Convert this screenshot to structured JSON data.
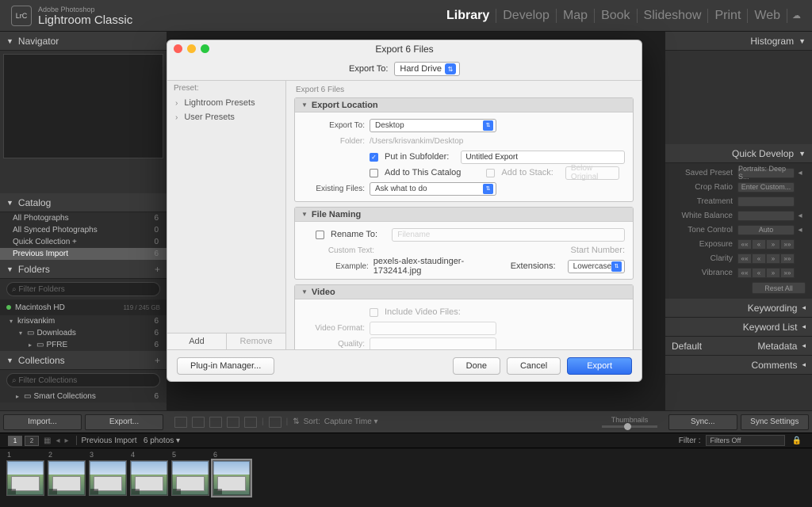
{
  "brand": {
    "sub": "Adobe Photoshop",
    "main": "Lightroom Classic",
    "logo": "LrC"
  },
  "modules": {
    "items": [
      "Library",
      "Develop",
      "Map",
      "Book",
      "Slideshow",
      "Print",
      "Web"
    ],
    "active": "Library"
  },
  "left": {
    "navigator": "Navigator",
    "catalog": {
      "title": "Catalog",
      "rows": [
        {
          "label": "All Photographs",
          "count": "6"
        },
        {
          "label": "All Synced Photographs",
          "count": "0"
        },
        {
          "label": "Quick Collection  +",
          "count": "0"
        },
        {
          "label": "Previous Import",
          "count": "6"
        }
      ],
      "selected": 3
    },
    "folders": {
      "title": "Folders",
      "search_placeholder": "Filter Folders",
      "drive": {
        "name": "Macintosh HD",
        "space": "119 / 245 GB"
      },
      "tree": [
        {
          "indent": 0,
          "exp": "▾",
          "label": "krisvankim",
          "count": "6"
        },
        {
          "indent": 1,
          "exp": "▾",
          "label": "Downloads",
          "count": "6"
        },
        {
          "indent": 2,
          "exp": "▸",
          "label": "PFRE",
          "count": "6"
        }
      ]
    },
    "collections": {
      "title": "Collections",
      "search_placeholder": "Filter Collections",
      "rows": [
        {
          "label": "Smart Collections",
          "count": "6"
        }
      ]
    },
    "import_btn": "Import...",
    "export_btn": "Export..."
  },
  "right": {
    "histogram": "Histogram",
    "quick_develop": {
      "title": "Quick Develop",
      "saved_preset_lbl": "Saved Preset",
      "saved_preset_val": "Portraits: Deep S...",
      "crop_lbl": "Crop Ratio",
      "crop_val": "Enter Custom...",
      "treatment_lbl": "Treatment",
      "treatment_val": "",
      "wb_lbl": "White Balance",
      "wb_val": "",
      "tone_lbl": "Tone Control",
      "tone_val": "Auto",
      "exposure_lbl": "Exposure",
      "clarity_lbl": "Clarity",
      "vibrance_lbl": "Vibrance",
      "reset": "Reset All"
    },
    "keywording": "Keywording",
    "keyword_list": "Keyword List",
    "metadata": {
      "title": "Metadata",
      "preset": "Default"
    },
    "comments": "Comments",
    "sync": "Sync...",
    "sync_settings": "Sync Settings"
  },
  "toolbar": {
    "sort_label": "Sort:",
    "sort_value": "Capture Time",
    "thumb_label": "Thumbnails"
  },
  "status": {
    "view1": "1",
    "view2": "2",
    "source": "Previous Import",
    "count": "6 photos",
    "filter_label": "Filter :",
    "filter_value": "Filters Off"
  },
  "filmstrip": {
    "count": 6,
    "selected": 5
  },
  "dialog": {
    "title": "Export 6 Files",
    "export_to_label": "Export To:",
    "export_to_value": "Hard Drive",
    "preset_header": "Preset:",
    "presets": [
      "Lightroom Presets",
      "User Presets"
    ],
    "add": "Add",
    "remove": "Remove",
    "section_label": "Export 6 Files",
    "location": {
      "title": "Export Location",
      "export_to_lbl": "Export To:",
      "export_to_val": "Desktop",
      "folder_lbl": "Folder:",
      "folder_val": "/Users/krisvankim/Desktop",
      "subfolder_cb": "Put in Subfolder:",
      "subfolder_val": "Untitled Export",
      "add_catalog": "Add to This Catalog",
      "add_stack": "Add to Stack:",
      "stack_val": "Below Original",
      "existing_lbl": "Existing Files:",
      "existing_val": "Ask what to do"
    },
    "naming": {
      "title": "File Naming",
      "rename_cb": "Rename To:",
      "rename_val": "Filename",
      "custom_lbl": "Custom Text:",
      "start_lbl": "Start Number:",
      "example_lbl": "Example:",
      "example_val": "pexels-alex-staudinger-1732414.jpg",
      "ext_lbl": "Extensions:",
      "ext_val": "Lowercase"
    },
    "video": {
      "title": "Video",
      "include": "Include Video Files:",
      "format_lbl": "Video Format:",
      "quality_lbl": "Quality:"
    },
    "plugin": "Plug-in Manager...",
    "done": "Done",
    "cancel": "Cancel",
    "export": "Export"
  }
}
